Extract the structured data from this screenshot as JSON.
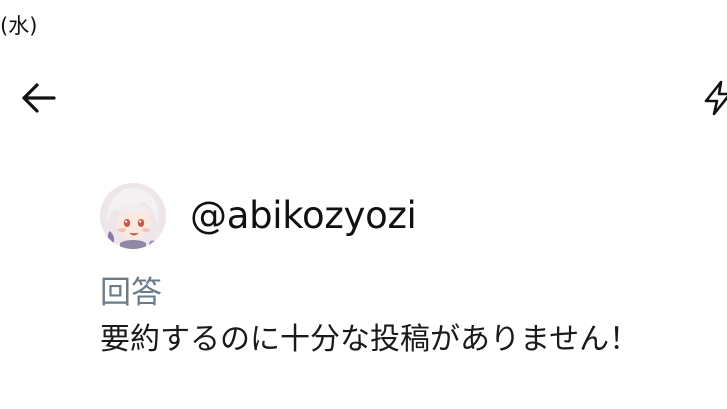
{
  "status_bar": {
    "date_fragment": "(水)"
  },
  "header": {
    "back_icon": "arrow-left-icon",
    "action_icon": "lightning-bolt-icon"
  },
  "post": {
    "avatar_icon": "user-avatar-anime-character",
    "handle": "@abikozyozi",
    "section_label": "回答",
    "body": "要約するのに十分な投稿がありません！"
  },
  "colors": {
    "background": "#ffffff",
    "text": "#111111",
    "label_muted": "#6b7c88"
  }
}
